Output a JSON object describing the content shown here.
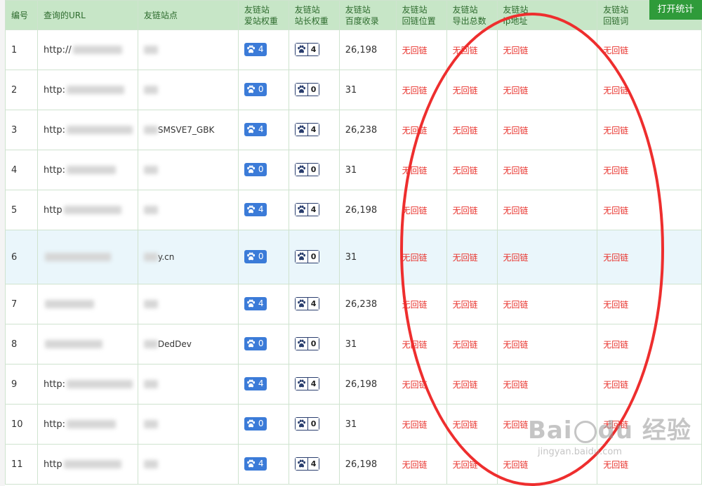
{
  "toolbar": {
    "stat_button": "打开统计"
  },
  "table": {
    "headers": [
      {
        "line1": "编号",
        "line2": ""
      },
      {
        "line1": "查询的URL",
        "line2": ""
      },
      {
        "line1": "友链站点",
        "line2": ""
      },
      {
        "line1": "友链站",
        "line2": "爱站权重"
      },
      {
        "line1": "友链站",
        "line2": "站长权重"
      },
      {
        "line1": "友链站",
        "line2": "百度收录"
      },
      {
        "line1": "友链站",
        "line2": "回链位置"
      },
      {
        "line1": "友链站",
        "line2": "导出总数"
      },
      {
        "line1": "友链站",
        "line2": "ip地址"
      },
      {
        "line1": "友链站",
        "line2": "回链词"
      }
    ],
    "rows": [
      {
        "id": "1",
        "url": "http://",
        "site": "",
        "aizhan": "4",
        "chinaz": "4",
        "baidu": "26,198",
        "pos": "无回链",
        "export": "无回链",
        "ip": "无回链",
        "word": "无回链"
      },
      {
        "id": "2",
        "url": "http:",
        "site": "",
        "aizhan": "0",
        "chinaz": "0",
        "baidu": "31",
        "pos": "无回链",
        "export": "无回链",
        "ip": "无回链",
        "word": "无回链"
      },
      {
        "id": "3",
        "url": "http:",
        "site": "SMSVE7_GBK",
        "aizhan": "4",
        "chinaz": "4",
        "baidu": "26,238",
        "pos": "无回链",
        "export": "无回链",
        "ip": "无回链",
        "word": "无回链"
      },
      {
        "id": "4",
        "url": "http:",
        "site": "",
        "aizhan": "0",
        "chinaz": "0",
        "baidu": "31",
        "pos": "无回链",
        "export": "无回链",
        "ip": "无回链",
        "word": "无回链"
      },
      {
        "id": "5",
        "url": "http",
        "site": "",
        "aizhan": "4",
        "chinaz": "4",
        "baidu": "26,198",
        "pos": "无回链",
        "export": "无回链",
        "ip": "无回链",
        "word": "无回链"
      },
      {
        "id": "6",
        "url": "",
        "site": "y.cn",
        "aizhan": "0",
        "chinaz": "0",
        "baidu": "31",
        "pos": "无回链",
        "export": "无回链",
        "ip": "无回链",
        "word": "无回链"
      },
      {
        "id": "7",
        "url": "",
        "site": "",
        "aizhan": "4",
        "chinaz": "4",
        "baidu": "26,238",
        "pos": "无回链",
        "export": "无回链",
        "ip": "无回链",
        "word": "无回链"
      },
      {
        "id": "8",
        "url": "",
        "site": "DedDev",
        "aizhan": "0",
        "chinaz": "0",
        "baidu": "31",
        "pos": "无回链",
        "export": "无回链",
        "ip": "无回链",
        "word": "无回链"
      },
      {
        "id": "9",
        "url": "http:",
        "site": "",
        "aizhan": "4",
        "chinaz": "4",
        "baidu": "26,198",
        "pos": "无回链",
        "export": "无回链",
        "ip": "无回链",
        "word": "无回链"
      },
      {
        "id": "10",
        "url": "http:",
        "site": "",
        "aizhan": "0",
        "chinaz": "0",
        "baidu": "31",
        "pos": "无回链",
        "export": "无回链",
        "ip": "无回链",
        "word": "无回链"
      },
      {
        "id": "11",
        "url": "http",
        "site": "",
        "aizhan": "4",
        "chinaz": "4",
        "baidu": "26,198",
        "pos": "无回链",
        "export": "无回链",
        "ip": "无回链",
        "word": "无回链"
      }
    ],
    "highlight_row": 6
  },
  "watermark": {
    "brand": "Bai",
    "brand2": "du",
    "cn": "经验",
    "url": "jingyan.baidu.com"
  },
  "colors": {
    "header_bg": "#c7e6c7",
    "accent_red": "#e8302a",
    "button_green": "#2f9b3a",
    "aizhan_blue": "#3b7bd8",
    "chinaz_navy": "#2a3e6e"
  }
}
